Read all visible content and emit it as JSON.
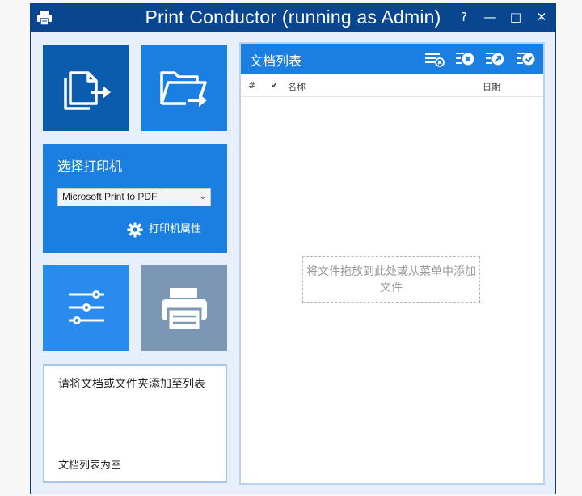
{
  "window": {
    "title": "Print Conductor (running as Admin)",
    "help_label": "?",
    "minimize_label": "—",
    "maximize_label": "□",
    "close_label": "✕"
  },
  "printer": {
    "label": "选择打印机",
    "selected": "Microsoft Print to PDF",
    "properties_label": "打印机属性"
  },
  "status": {
    "message": "请将文档或文件夹添加至列表",
    "list_state": "文档列表为空"
  },
  "doc_list": {
    "title": "文档列表",
    "columns": {
      "index": "#",
      "check": "✔",
      "name": "名称",
      "date": "日期"
    },
    "dropzone_text": "将文件拖放到此处或从菜单中添加文件"
  },
  "colors": {
    "title_bar": "#0a468f",
    "tile_dark": "#0b5cad",
    "tile_blue": "#1a7fe0",
    "tile_disabled": "#7b97b3"
  },
  "icons": {
    "app": "printer-icon",
    "add_files": "add-files-icon",
    "add_folder": "add-folder-icon",
    "settings": "sliders-icon",
    "print": "printer-icon",
    "header": [
      "remove-selected-icon",
      "remove-icon",
      "move-icon",
      "clear-list-icon"
    ]
  }
}
